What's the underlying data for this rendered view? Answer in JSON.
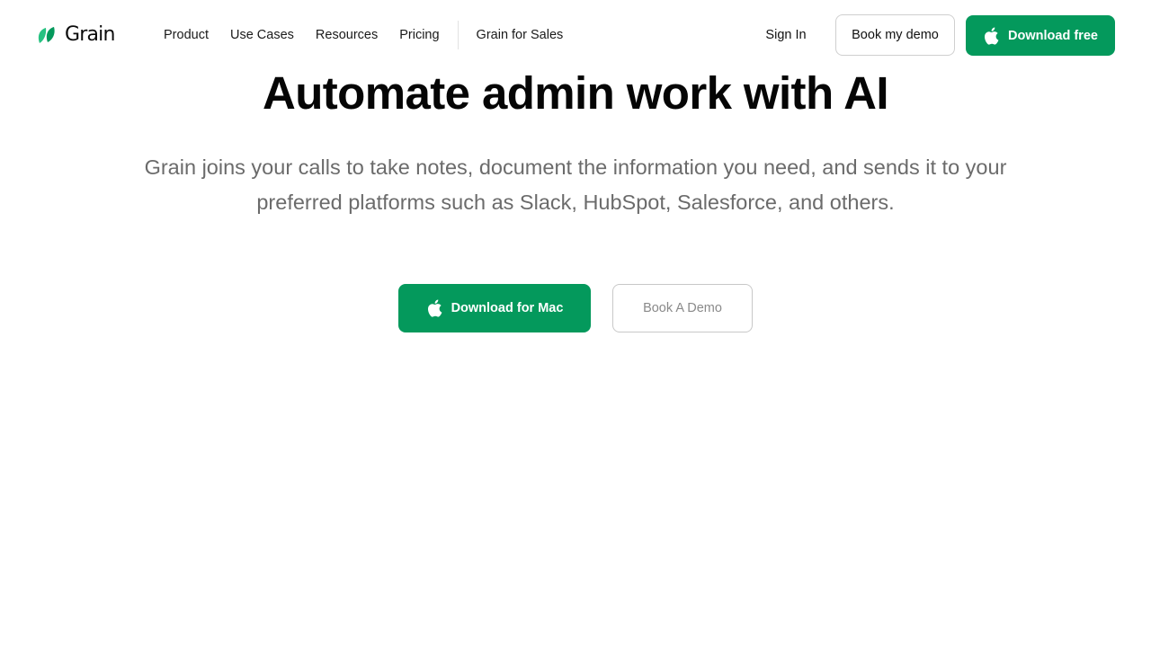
{
  "brand": {
    "name": "Grain",
    "logo_icon": "leaf-logo-icon",
    "color": "#04995c"
  },
  "nav": {
    "links": [
      "Product",
      "Use Cases",
      "Resources",
      "Pricing"
    ],
    "extra_link": "Grain for Sales",
    "sign_in": "Sign In",
    "book_demo": "Book my demo",
    "download": "Download free",
    "download_icon": "apple-icon"
  },
  "hero": {
    "headline": "Automate admin work with AI",
    "subtitle": "Grain joins your calls to take notes, document the information you need, and sends it to your preferred platforms such as Slack, HubSpot, Salesforce, and others.",
    "primary_cta": "Download for Mac",
    "primary_icon": "apple-icon",
    "secondary_cta": "Book A Demo"
  }
}
